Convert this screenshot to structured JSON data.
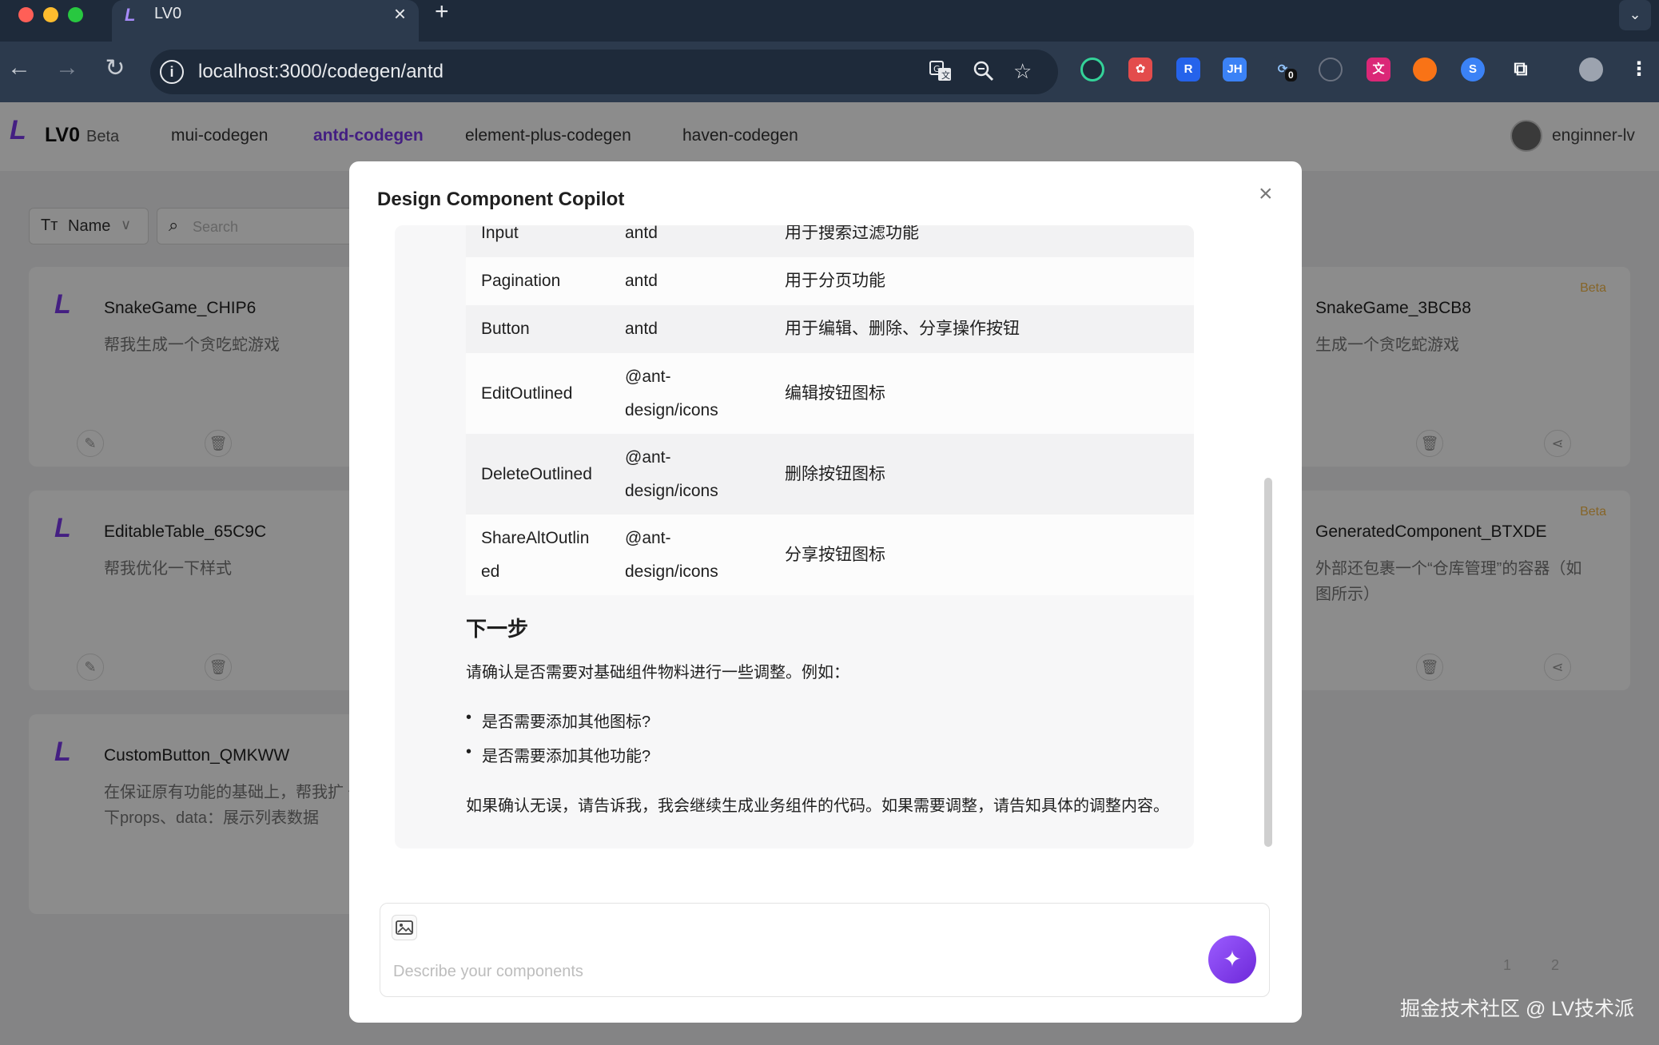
{
  "browser": {
    "tab_title": "LV0",
    "tab_close": "×",
    "new_tab": "+",
    "url": "localhost:3000/codegen/antd",
    "info_icon": "i",
    "extension_badge": "0",
    "extension_jh": "JH"
  },
  "app": {
    "name": "LV0",
    "beta": "Beta",
    "nav": [
      "mui-codegen",
      "antd-codegen",
      "element-plus-codegen",
      "haven-codegen"
    ],
    "active_nav": "antd-codegen",
    "user": "enginner-lv",
    "filter_label": "Name",
    "search_placeholder": "Search"
  },
  "cards": [
    {
      "title": "SnakeGame_CHIP6",
      "desc": "帮我生成一个贪吃蛇游戏"
    },
    {
      "title": "SnakeGame_3BCB8",
      "desc": "生成一个贪吃蛇游戏",
      "badge": "Beta"
    },
    {
      "title": "EditableTable_65C9C",
      "desc": "帮我优化一下样式"
    },
    {
      "title": "GeneratedComponent_BTXDE",
      "desc": "外部还包裹一个“仓库管理”的容器（如图所示）",
      "badge": "Beta"
    },
    {
      "title": "CustomButton_QMKWW",
      "desc": "在保证原有功能的基础上，帮我扩 一下props、data：展示列表数据"
    }
  ],
  "pagination": [
    "1",
    "2"
  ],
  "modal": {
    "title": "Design Component Copilot",
    "close": "×",
    "table_rows": [
      {
        "name": "Input",
        "source": "antd",
        "desc": "用于搜索过滤功能"
      },
      {
        "name": "Pagination",
        "source": "antd",
        "desc": "用于分页功能"
      },
      {
        "name": "Button",
        "source": "antd",
        "desc": "用于编辑、删除、分享操作按钮"
      },
      {
        "name": "EditOutlined",
        "source": "@ant-design/icons",
        "desc": "编辑按钮图标"
      },
      {
        "name": "DeleteOutlined",
        "source": "@ant-design/icons",
        "desc": "删除按钮图标"
      },
      {
        "name": "ShareAltOutlined",
        "source": "@ant-design/icons",
        "desc": "分享按钮图标"
      }
    ],
    "next_title": "下一步",
    "confirm_text": "请确认是否需要对基础组件物料进行一些调整。例如：",
    "bullets": [
      "是否需要添加其他图标?",
      "是否需要添加其他功能?"
    ],
    "closing_text": "如果确认无误，请告诉我，我会继续生成业务组件的代码。如果需要调整，请告知具体的调整内容。",
    "input_placeholder": "Describe your components"
  },
  "watermark": "掘金技术社区 @ LV技术派",
  "colors": {
    "accent": "#7c3aed",
    "chrome": "#1e2a3a",
    "overlay": "rgba(0,0,0,0.45)"
  }
}
